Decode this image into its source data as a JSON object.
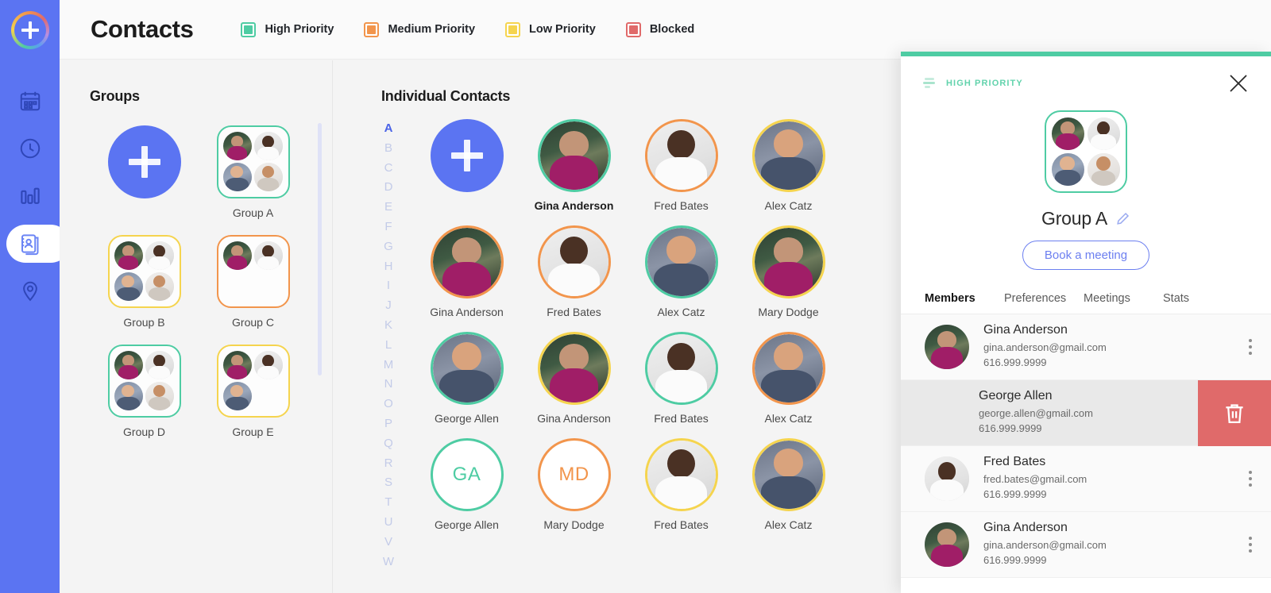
{
  "header": {
    "title": "Contacts",
    "add_button_label": "+",
    "legend": [
      {
        "label": "High Priority",
        "color": "#4ecca3"
      },
      {
        "label": "Medium Priority",
        "color": "#f2954c"
      },
      {
        "label": "Low Priority",
        "color": "#f5d44e"
      },
      {
        "label": "Blocked",
        "color": "#e06a6a"
      }
    ]
  },
  "sidebar": {
    "background": "#5b74f2",
    "items": [
      {
        "icon": "calendar-icon",
        "active": false
      },
      {
        "icon": "clock-icon",
        "active": false
      },
      {
        "icon": "bar-chart-icon",
        "active": false
      },
      {
        "icon": "contacts-icon",
        "active": true
      },
      {
        "icon": "location-pin-icon",
        "active": false
      }
    ]
  },
  "groups": {
    "title": "Groups",
    "add_label": "+",
    "items": [
      {
        "label": "Group A",
        "color": "#4ecca3",
        "members": [
          "gina",
          "fred",
          "george",
          "mike"
        ]
      },
      {
        "label": "Group B",
        "color": "#f5d44e",
        "members": [
          "gina",
          "fred",
          "george",
          "mike"
        ]
      },
      {
        "label": "Group C",
        "color": "#f2954c",
        "members": [
          "gina",
          "fred"
        ]
      },
      {
        "label": "Group D",
        "color": "#4ecca3",
        "members": [
          "gina",
          "fred",
          "george",
          "mike"
        ]
      },
      {
        "label": "Group E",
        "color": "#f5d44e",
        "members": [
          "gina",
          "fred",
          "george"
        ]
      }
    ]
  },
  "contacts": {
    "title": "Individual Contacts",
    "alphabet": [
      "A",
      "B",
      "C",
      "D",
      "E",
      "F",
      "G",
      "H",
      "I",
      "J",
      "K",
      "L",
      "M",
      "N",
      "O",
      "P",
      "Q",
      "R",
      "S",
      "T",
      "U",
      "V",
      "W"
    ],
    "active_letter": "A",
    "add_label": "+",
    "items": [
      {
        "name": "Gina Anderson",
        "color": "#4ecca3",
        "photo": "gina",
        "initials": "",
        "hover": true
      },
      {
        "name": "Fred Bates",
        "color": "#f2954c",
        "photo": "fred",
        "initials": "",
        "hover": false
      },
      {
        "name": "Alex Catz",
        "color": "#f5d44e",
        "photo": "alex",
        "initials": "",
        "hover": false
      },
      {
        "name": "Gina Anderson",
        "color": "#f2954c",
        "photo": "gina",
        "initials": "",
        "hover": false
      },
      {
        "name": "Fred Bates",
        "color": "#f2954c",
        "photo": "fred",
        "initials": "",
        "hover": false
      },
      {
        "name": "Alex Catz",
        "color": "#4ecca3",
        "photo": "alex",
        "initials": "",
        "hover": false
      },
      {
        "name": "Mary Dodge",
        "color": "#f5d44e",
        "photo": "gina",
        "initials": "",
        "hover": false
      },
      {
        "name": "George Allen",
        "color": "#4ecca3",
        "photo": "alex",
        "initials": "",
        "hover": false
      },
      {
        "name": "Gina Anderson",
        "color": "#f5d44e",
        "photo": "gina",
        "initials": "",
        "hover": false
      },
      {
        "name": "Fred Bates",
        "color": "#4ecca3",
        "photo": "fred",
        "initials": "",
        "hover": false
      },
      {
        "name": "Alex Catz",
        "color": "#f2954c",
        "photo": "alex",
        "initials": "",
        "hover": false
      },
      {
        "name": "George Allen",
        "color": "#4ecca3",
        "photo": "",
        "initials": "GA",
        "hover": false
      },
      {
        "name": "Mary Dodge",
        "color": "#f2954c",
        "photo": "",
        "initials": "MD",
        "hover": false
      },
      {
        "name": "Fred Bates",
        "color": "#f5d44e",
        "photo": "fred",
        "initials": "",
        "hover": false
      },
      {
        "name": "Alex Catz",
        "color": "#f5d44e",
        "photo": "alex",
        "initials": "",
        "hover": false
      }
    ]
  },
  "panel": {
    "priority_label": "HIGH PRIORITY",
    "priority_color": "#4ecca3",
    "close_label": "×",
    "group_name": "Group A",
    "edit_label": "edit",
    "book_button": "Book a meeting",
    "avatars": [
      "gina",
      "fred",
      "george",
      "mike"
    ],
    "tabs": [
      {
        "label": "Members",
        "active": true
      },
      {
        "label": "Preferences",
        "active": false
      },
      {
        "label": "Meetings",
        "active": false
      },
      {
        "label": "Stats",
        "active": false
      }
    ],
    "members": [
      {
        "name": "Gina Anderson",
        "email": "gina.anderson@gmail.com",
        "phone": "616.999.9999",
        "photo": "gina",
        "swiped": false
      },
      {
        "name": "George Allen",
        "email": "george.allen@gmail.com",
        "phone": "616.999.9999",
        "photo": "george",
        "swiped": true
      },
      {
        "name": "Fred Bates",
        "email": "fred.bates@gmail.com",
        "phone": "616.999.9999",
        "photo": "fred",
        "swiped": false
      },
      {
        "name": "Gina Anderson",
        "email": "gina.anderson@gmail.com",
        "phone": "616.999.9999",
        "photo": "gina",
        "swiped": false
      }
    ],
    "delete_label": "Delete"
  }
}
